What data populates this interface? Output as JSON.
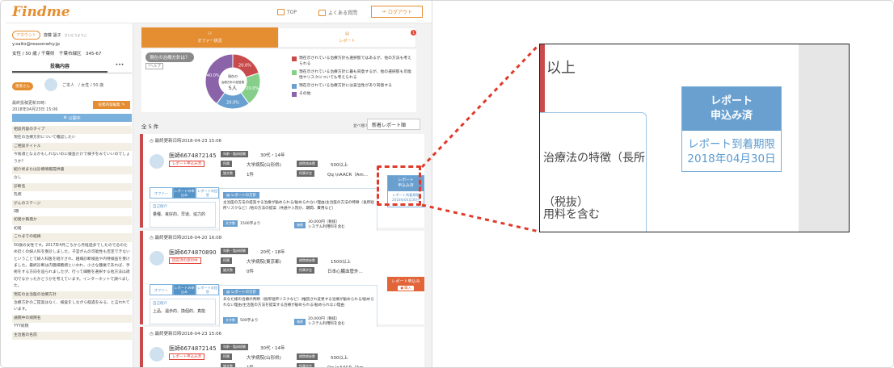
{
  "header": {
    "logo": "Findme",
    "top": "TOP",
    "faq": "よくある質問",
    "logout": "ログアウト"
  },
  "side": {
    "account_tag": "アカウント",
    "user_name": "齋藤 謡子",
    "user_kana": "さいとうようこ",
    "email": "y.saito@reasonwhy.jp",
    "profile": "女性 / 50 歳 / 千葉県　千葉市緑区　345-67",
    "tab_post": "投稿内容",
    "tab_more": "•••",
    "badge": "患者さん",
    "person": "ご本人　/ 女性 / 50 歳",
    "updated": "最終投稿更新日時：",
    "updated_date": "2018年04月23日 15:06",
    "edit": "投稿内容編集",
    "pub": "公開中",
    "items": [
      {
        "t": "相談内容のタイプ",
        "h": true
      },
      {
        "t": "現在の治療方針について確認したい",
        "h": false
      },
      {
        "t": "ご相談タイトル",
        "h": true
      },
      {
        "t": "今後適となるかもしれないのに検査だけで様子をみていいのでしょうか？",
        "h": false
      },
      {
        "t": "紹介状または診療情報提供書",
        "h": true
      },
      {
        "t": "なし",
        "h": false
      },
      {
        "t": "診断名",
        "h": true
      },
      {
        "t": "乳癌",
        "h": false
      },
      {
        "t": "がんのステージ",
        "h": true
      },
      {
        "t": "I期",
        "h": false
      },
      {
        "t": "初発か再発か",
        "h": true
      },
      {
        "t": "初発",
        "h": false
      },
      {
        "t": "これまでの経緯",
        "h": true
      },
      {
        "t": "50歳の女性です。2017年4月ごろから月経過多でしたので念のため近くの婦人科を受診しました。子宮がんの可能性も否定できないということで婦人科医を紹介され、組織診断検査や内特検査を受けました。最終診断は内膜細胞癌といわれ、小さな腫瘍であれば、手術をする方向を迫られましたが、行って細胞を選択する他方法は適切でなかったかどうかを考えています。インターネットで調べました。",
        "h": false
      },
      {
        "t": "現在の主治医の治療方針",
        "h": true
      },
      {
        "t": "治療方針のご提案はなく、検査をしながら経過をみる、と言われています。",
        "h": false
      },
      {
        "t": "通院中の病院名",
        "h": true
      },
      {
        "t": "YYY病院",
        "h": false
      },
      {
        "t": "主治医の名前",
        "h": true
      }
    ]
  },
  "tabs": {
    "offer": "オファー状況",
    "report": "レポート",
    "notif": "1"
  },
  "summary": {
    "title": "現在の治療方針は？",
    "help": "ヘルプ",
    "center_l1": "現在の",
    "center_l2": "治療方針の回答数",
    "center_n": "5人"
  },
  "chart_data": {
    "type": "pie",
    "categories": [
      "現在示されている治療方針も選択肢ではあるが、他の方法も考えられる",
      "現在示されている治療方針に最も同意するが、他の選択肢も可能性やリスクについても考えられる",
      "現在示されている治療方針には妥当性があり同意する",
      "その他"
    ],
    "values": [
      20,
      20,
      20,
      40
    ],
    "labels": [
      "20.0%",
      "20.0%",
      "20.0%",
      "40.0%"
    ],
    "colors": [
      "#c94a4a",
      "#86cf8a",
      "#6aa0d0",
      "#8a63a8"
    ]
  },
  "list": {
    "count": "全 5 件",
    "sort_label": "並べ替え",
    "sort_value": "新着レポート順"
  },
  "cards": [
    {
      "date": "最終更新日時2018-04-23 15:06",
      "name": "医師6674872145",
      "status": "レポート申込み済",
      "age_lbl": "年齢・臨床経験",
      "age": "30代・14年",
      "area_lbl": "所属",
      "area": "大学病院(山形県)",
      "beds_lbl": "病院病床数",
      "beds": "500以上",
      "cases_lbl": "論文数",
      "cases": "1件",
      "spec_lbl": "所属学会",
      "spec": "Qq \\nAACR（Am...",
      "steps": [
        "オファー",
        "レポートの申込み",
        "レポートの回答"
      ],
      "prof_t": "自己紹介",
      "prof": "量種、良好的、早道、協力的",
      "mh": "レポートの方針",
      "mt": "主治医の方法の提案する治療が勧められる/勧められない理由/主治医の方法の特徴（長所短所リスクなど）/他の方法の提案（共通や入院か、期間、費用など）",
      "s1_lbl": "文字数",
      "s1": "1500字より",
      "s2_lbl": "価格",
      "s2": "30,000円（税抜）",
      "s3": "システム利用料を含む",
      "rep_h1": "レポート",
      "rep_h2": "申込み済",
      "rep_d1": "レポート到着期限",
      "rep_d2": "2018年04月30日"
    },
    {
      "date": "最終更新日時2018-04-20 16:08",
      "name": "医師6674870890",
      "status": "回答済の受付中",
      "age_lbl": "年齢・臨床経験",
      "age": "20代・18年",
      "area_lbl": "所属",
      "area": "大学病院(東京都)",
      "beds_lbl": "病院病床数",
      "beds": "1500以上",
      "cases_lbl": "論文数",
      "cases": "0件",
      "spec_lbl": "所属学会",
      "spec": "日本心臓血管外...",
      "steps": [
        "オファー",
        "レポートの申込み",
        "レポートの回答"
      ],
      "prof_t": "自己紹介",
      "prof": "上品、温歩的、換個的、真能",
      "mh": "レポートの方針",
      "mt": "あなた様の治療の判断（長所短所リスクなど）/推奨され変更する治療が勧められる/勧められない理由/主治医の方法を提案する治療が勧められる/勧められない理由",
      "s1_lbl": "文字数",
      "s1": "500字より",
      "s2_lbl": "価格",
      "s2": "20,000円（税抜）",
      "s3": "システム利用料を含む",
      "btn": "レポート申込み",
      "btn_sub": "● 購入"
    },
    {
      "date": "最終更新日時2018-04-23 15:06",
      "name": "医師6674872145",
      "status": "レポート申込み済",
      "age_lbl": "年齢・臨床経験",
      "age": "30代・14年",
      "area_lbl": "所属",
      "area": "大学病院(山形県)",
      "beds_lbl": "病院病床数",
      "beds": "500以上",
      "cases_lbl": "論文数",
      "cases": "1件",
      "spec_lbl": "所属学会",
      "spec": "Qq \\nAACR（Am..."
    }
  ],
  "zoom": {
    "t_top": "以上",
    "t1": "治療法の特徴（長所",
    "t2a": "（税抜）",
    "t2b": "用料を含む",
    "rh1": "レポート",
    "rh2": "申込み済",
    "rd1": "レポート到着期限",
    "rd2": "2018年04月30日"
  }
}
